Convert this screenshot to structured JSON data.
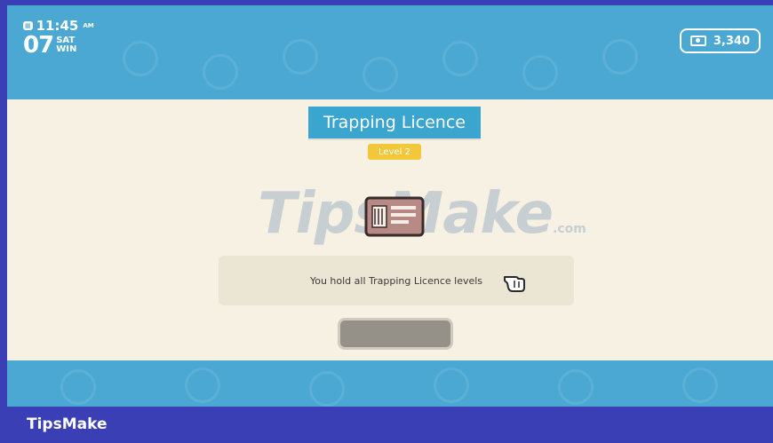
{
  "clock": {
    "time": "11:45",
    "ampm": "AM",
    "day": "07",
    "weekday": "SAT",
    "season": "WIN"
  },
  "currency": {
    "amount": "3,340",
    "icon": "cash-icon"
  },
  "dialog": {
    "title": "Trapping Licence",
    "level": "Level 2",
    "message": "You hold all Trapping Licence levels",
    "licence_icon": "licence-card-icon",
    "pointer_icon": "hand-pointer-icon"
  },
  "watermark": {
    "main": "TipsMake",
    "suffix": ".com"
  },
  "footer": {
    "label": "TipsMake"
  },
  "colors": {
    "sky": "#4aa8d3",
    "cream": "#f7f1e3",
    "title_bg": "#3aa5cf",
    "level_bg": "#f2c83a",
    "footer": "#3a3fb5"
  }
}
